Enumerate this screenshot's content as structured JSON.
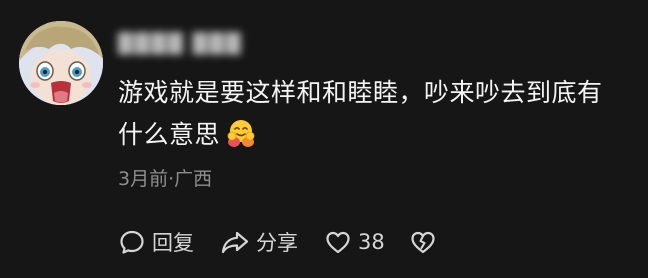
{
  "comment": {
    "username": "████ ███",
    "text": "游戏就是要这样和和睦睦，吵来吵去到底有什么意思",
    "emoji": "hugging-face-emoji",
    "time_location": "3月前·广西"
  },
  "actions": {
    "reply_label": "回复",
    "share_label": "分享",
    "like_count": "38",
    "dislike_icon": "broken-heart-icon"
  },
  "colors": {
    "background": "#161616",
    "text": "#f4f4f4",
    "meta": "#8e8e8e",
    "action": "#d6d6d6"
  }
}
